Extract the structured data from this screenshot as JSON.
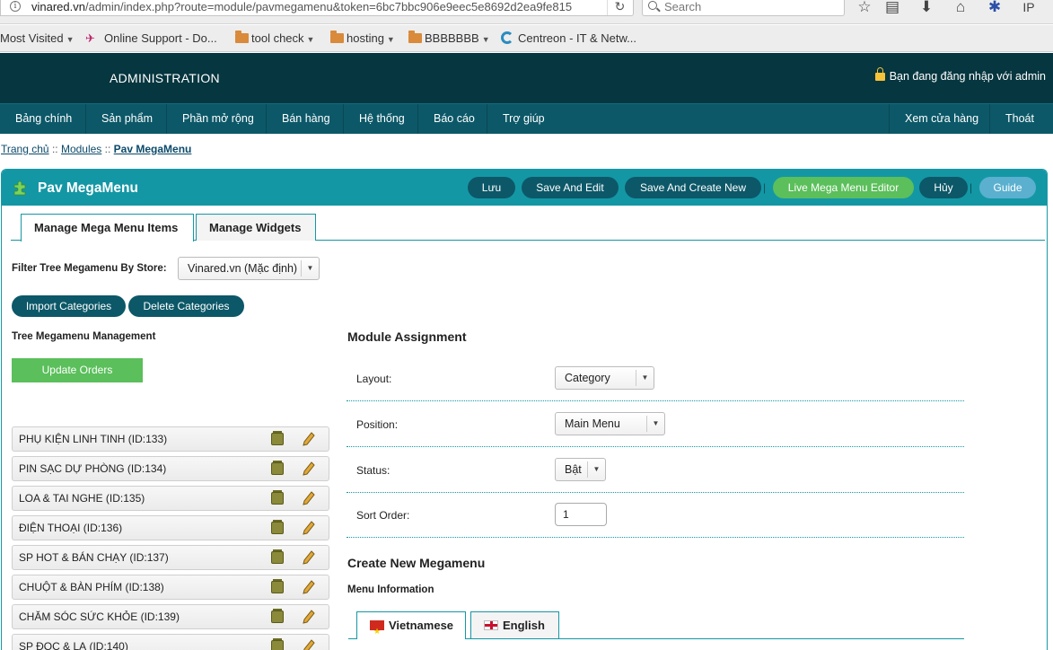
{
  "browser": {
    "url": "vinared.vn/admin/index.php?route=module/pavmegamenu&token=6bc7bbc906e9eec5e8692d2ea9fe815",
    "url_domain": "vinared.vn",
    "url_path": "/admin/index.php?route=module/pavmegamenu&token=6bc7bbc906e9eec5e8692d2ea9fe815",
    "search_placeholder": "Search",
    "bookmarks": [
      {
        "label": "Most Visited",
        "type": "menu"
      },
      {
        "label": "Online Support - Do...",
        "type": "site"
      },
      {
        "label": "tool check",
        "type": "folder"
      },
      {
        "label": "hosting",
        "type": "folder"
      },
      {
        "label": "BBBBBBB",
        "type": "folder"
      },
      {
        "label": "Centreon - IT & Netw...",
        "type": "site"
      }
    ]
  },
  "header": {
    "title": "ADMINISTRATION",
    "login_text": "Bạn đang đăng nhập với admin"
  },
  "nav": {
    "items": [
      "Bảng chính",
      "Sản phẩm",
      "Phần mở rộng",
      "Bán hàng",
      "Hệ thống",
      "Báo cáo",
      "Trợ giúp"
    ],
    "right_items": [
      "Xem cửa hàng",
      "Thoát"
    ]
  },
  "breadcrumb": {
    "home": "Trang chủ",
    "sep": "::",
    "modules": "Modules",
    "current": "Pav MegaMenu"
  },
  "panel": {
    "title": "Pav MegaMenu",
    "buttons": {
      "save": "Lưu",
      "save_edit": "Save And Edit",
      "save_new": "Save And Create New",
      "live_editor": "Live Mega Menu Editor",
      "cancel": "Hủy",
      "guide": "Guide"
    },
    "separator": "|",
    "tabs": [
      "Manage Mega Menu Items",
      "Manage Widgets"
    ],
    "filter_label": "Filter Tree Megamenu By Store:",
    "store_value": "Vinared.vn (Mặc định)",
    "import_label": "Import Categories",
    "delete_label": "Delete Categories",
    "tree_title": "Tree Megamenu Management",
    "update_label": "Update Orders",
    "tree_items": [
      "PHỤ KIỆN LINH TINH (ID:133)",
      "PIN SẠC DỰ PHÒNG (ID:134)",
      "LOA & TAI NGHE (ID:135)",
      "ĐIỆN THOẠI (ID:136)",
      "SP HOT & BÁN CHẠY (ID:137)",
      "CHUỘT & BÀN PHÍM (ID:138)",
      "CHĂM SÓC SỨC KHỎE (ID:139)",
      "SP ĐỌC & LẠ (ID:140)"
    ]
  },
  "assignment": {
    "title": "Module Assignment",
    "layout_label": "Layout:",
    "layout_value": "Category",
    "position_label": "Position:",
    "position_value": "Main Menu",
    "status_label": "Status:",
    "status_value": "Bật",
    "sort_label": "Sort Order:",
    "sort_value": "1"
  },
  "create": {
    "title": "Create New Megamenu",
    "info_label": "Menu Information",
    "lang_tabs": [
      "Vietnamese",
      "English"
    ]
  }
}
